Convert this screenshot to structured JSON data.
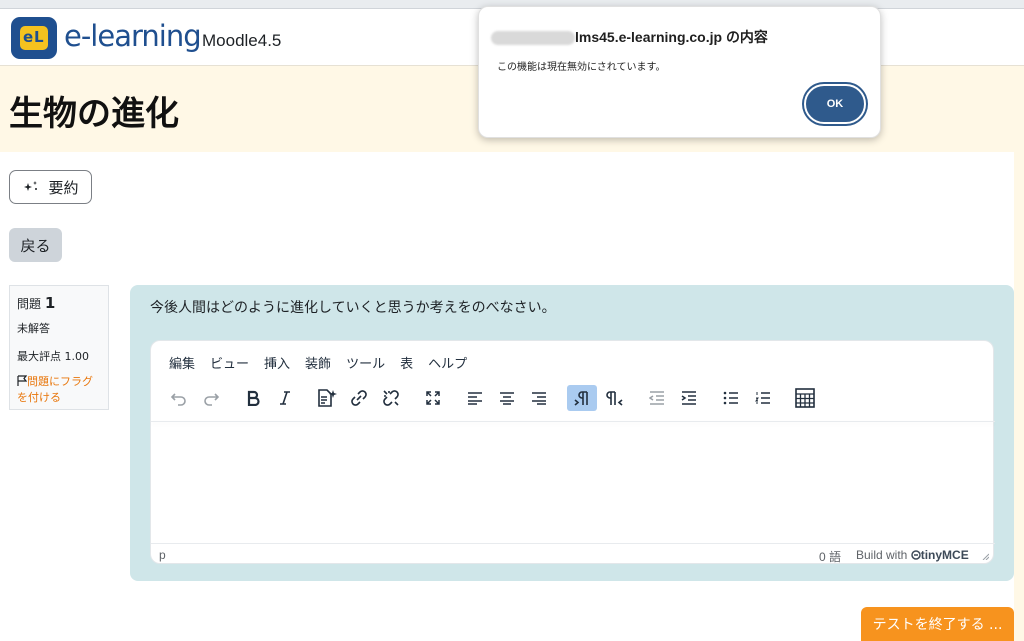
{
  "brand": {
    "name": "e-learning",
    "version": "Moodle4.5"
  },
  "page": {
    "title": "生物の進化"
  },
  "actions": {
    "summary_label": "要約",
    "back_label": "戻る",
    "finish_label": "テストを終了する ..."
  },
  "question": {
    "number_label": "問題",
    "number": "1",
    "state": "未解答",
    "grade": "最大評点 1.00",
    "flag_label": "問題にフラグを付ける",
    "text": "今後人間はどのように進化していくと思うか考えをのべなさい。"
  },
  "editor": {
    "menu": [
      "編集",
      "ビュー",
      "挿入",
      "装飾",
      "ツール",
      "表",
      "ヘルプ"
    ],
    "toolbar_icons": [
      "undo-icon",
      "redo-icon",
      "bold-icon",
      "italic-icon",
      "ai-generate-icon",
      "link-icon",
      "unlink-icon",
      "fullscreen-icon",
      "align-left-icon",
      "align-center-icon",
      "align-right-icon",
      "ltr-icon",
      "rtl-icon",
      "outdent-icon",
      "indent-icon",
      "bullet-list-icon",
      "numbered-list-icon",
      "calculator-icon"
    ],
    "status_path": "p",
    "word_count": "0 語",
    "build_prefix": "Build with",
    "build_brand": "tinyMCE"
  },
  "dialog": {
    "title": "lms45.e-learning.co.jp の内容",
    "message": "この機能は現在無効にされています。",
    "ok_label": "OK"
  },
  "colors": {
    "brand_blue": "#1f4f8f",
    "accent_orange": "#f7931e",
    "question_bg": "#cfe6e9",
    "page_bg": "#fff8e6"
  }
}
